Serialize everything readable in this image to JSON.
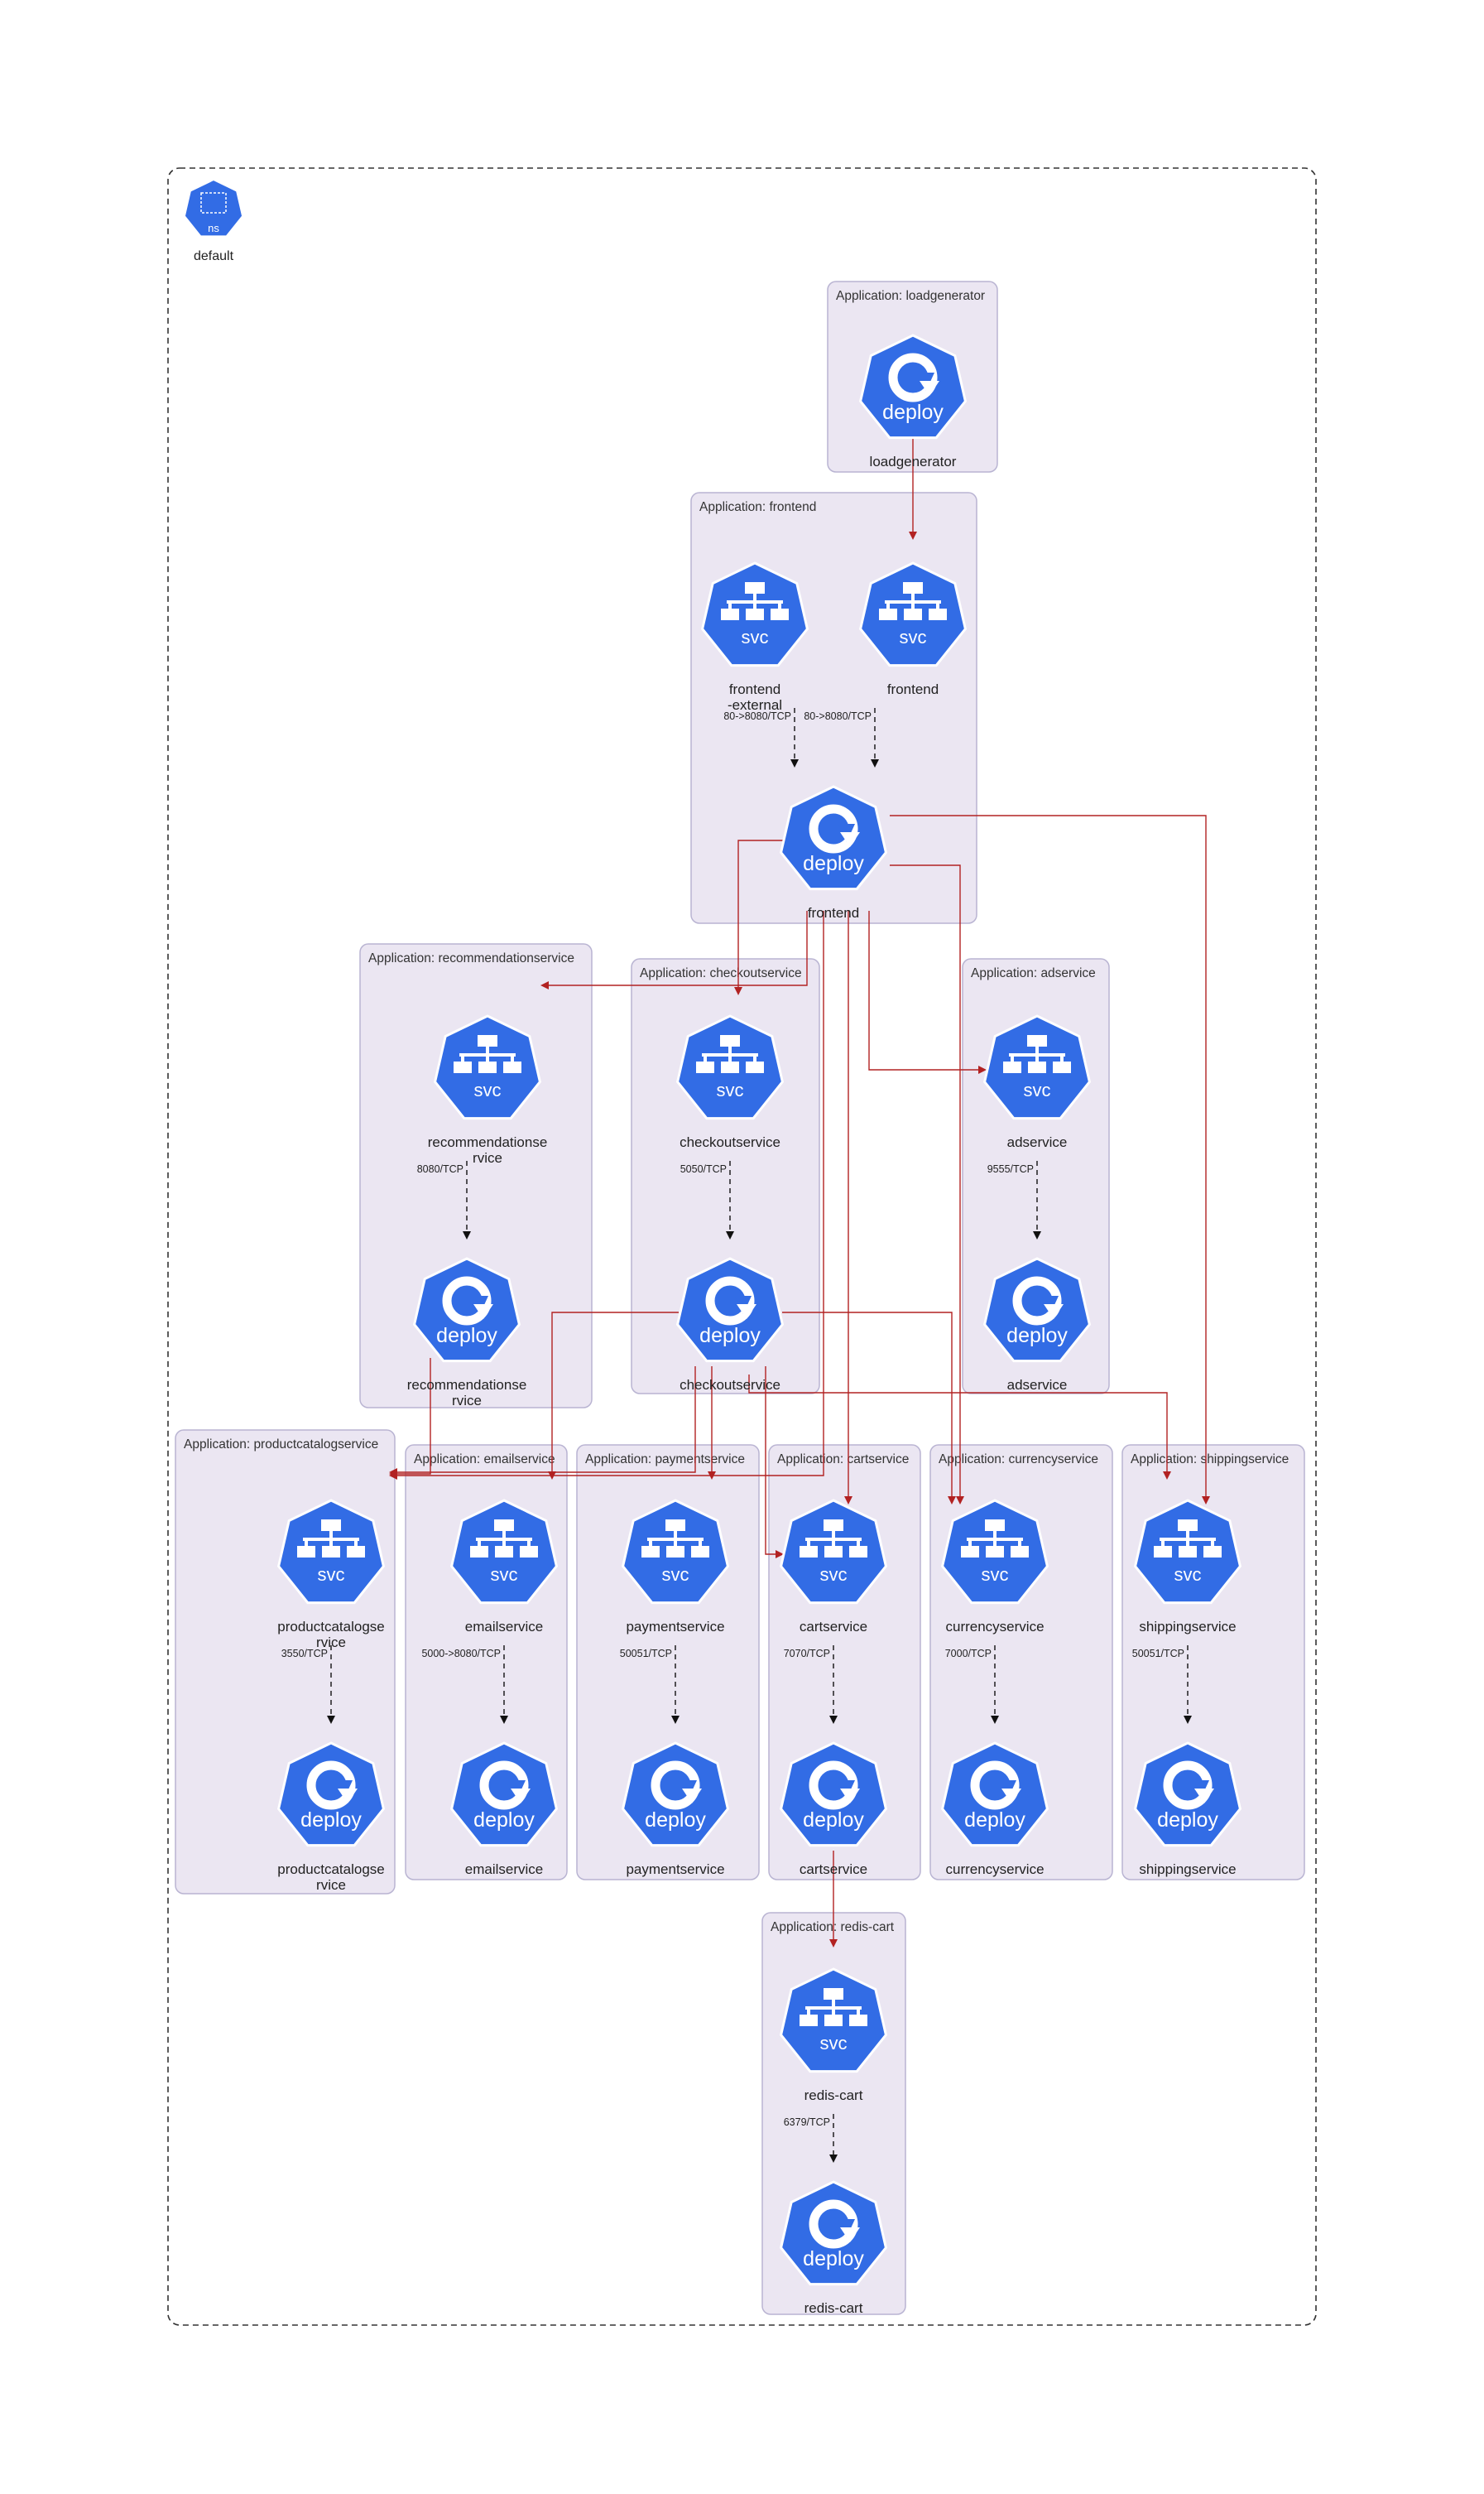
{
  "diagram": {
    "namespace": {
      "icon_text": "ns",
      "label": "default",
      "icon": "namespace-icon"
    },
    "colors": {
      "icon_fill": "#326ce5",
      "cluster_fill": "#ebe6f2",
      "cluster_stroke": "#b9b4d2",
      "traffic_edge": "#b22222",
      "port_edge": "#111111"
    },
    "clusters": [
      {
        "id": "loadgenerator",
        "title": "Application: loadgenerator"
      },
      {
        "id": "frontend",
        "title": "Application: frontend"
      },
      {
        "id": "recommendationservice",
        "title": "Application: recommendationservice"
      },
      {
        "id": "checkoutservice",
        "title": "Application: checkoutservice"
      },
      {
        "id": "adservice",
        "title": "Application: adservice"
      },
      {
        "id": "productcatalogservice",
        "title": "Application: productcatalogservice"
      },
      {
        "id": "emailservice",
        "title": "Application: emailservice"
      },
      {
        "id": "paymentservice",
        "title": "Application: paymentservice"
      },
      {
        "id": "cartservice",
        "title": "Application: cartservice"
      },
      {
        "id": "currencyservice",
        "title": "Application: currencyservice"
      },
      {
        "id": "shippingservice",
        "title": "Application: shippingservice"
      },
      {
        "id": "redis-cart",
        "title": "Application: redis-cart"
      }
    ],
    "nodes": [
      {
        "id": "loadgenerator-deploy",
        "kind": "deploy",
        "label": [
          "loadgenerator"
        ]
      },
      {
        "id": "frontend-external-svc",
        "kind": "svc",
        "label": [
          "frontend",
          "-external"
        ]
      },
      {
        "id": "frontend-svc",
        "kind": "svc",
        "label": [
          "frontend"
        ]
      },
      {
        "id": "frontend-deploy",
        "kind": "deploy",
        "label": [
          "frontend"
        ]
      },
      {
        "id": "recommendationservice-svc",
        "kind": "svc",
        "label": [
          "recommendationse",
          "rvice"
        ]
      },
      {
        "id": "recommendationservice-deploy",
        "kind": "deploy",
        "label": [
          "recommendationse",
          "rvice"
        ]
      },
      {
        "id": "checkoutservice-svc",
        "kind": "svc",
        "label": [
          "checkoutservice"
        ]
      },
      {
        "id": "checkoutservice-deploy",
        "kind": "deploy",
        "label": [
          "checkoutservice"
        ]
      },
      {
        "id": "adservice-svc",
        "kind": "svc",
        "label": [
          "adservice"
        ]
      },
      {
        "id": "adservice-deploy",
        "kind": "deploy",
        "label": [
          "adservice"
        ]
      },
      {
        "id": "productcatalogservice-svc",
        "kind": "svc",
        "label": [
          "productcatalogse",
          "rvice"
        ]
      },
      {
        "id": "productcatalogservice-deploy",
        "kind": "deploy",
        "label": [
          "productcatalogse",
          "rvice"
        ]
      },
      {
        "id": "emailservice-svc",
        "kind": "svc",
        "label": [
          "emailservice"
        ]
      },
      {
        "id": "emailservice-deploy",
        "kind": "deploy",
        "label": [
          "emailservice"
        ]
      },
      {
        "id": "paymentservice-svc",
        "kind": "svc",
        "label": [
          "paymentservice"
        ]
      },
      {
        "id": "paymentservice-deploy",
        "kind": "deploy",
        "label": [
          "paymentservice"
        ]
      },
      {
        "id": "cartservice-svc",
        "kind": "svc",
        "label": [
          "cartservice"
        ]
      },
      {
        "id": "cartservice-deploy",
        "kind": "deploy",
        "label": [
          "cartservice"
        ]
      },
      {
        "id": "currencyservice-svc",
        "kind": "svc",
        "label": [
          "currencyservice"
        ]
      },
      {
        "id": "currencyservice-deploy",
        "kind": "deploy",
        "label": [
          "currencyservice"
        ]
      },
      {
        "id": "shippingservice-svc",
        "kind": "svc",
        "label": [
          "shippingservice"
        ]
      },
      {
        "id": "shippingservice-deploy",
        "kind": "deploy",
        "label": [
          "shippingservice"
        ]
      },
      {
        "id": "redis-cart-svc",
        "kind": "svc",
        "label": [
          "redis-cart"
        ]
      },
      {
        "id": "redis-cart-deploy",
        "kind": "deploy",
        "label": [
          "redis-cart"
        ]
      }
    ],
    "port_edges": [
      {
        "from": "frontend-external-svc",
        "to": "frontend-deploy",
        "label": "80->8080/TCP"
      },
      {
        "from": "frontend-svc",
        "to": "frontend-deploy",
        "label": "80->8080/TCP"
      },
      {
        "from": "recommendationservice-svc",
        "to": "recommendationservice-deploy",
        "label": "8080/TCP"
      },
      {
        "from": "checkoutservice-svc",
        "to": "checkoutservice-deploy",
        "label": "5050/TCP"
      },
      {
        "from": "adservice-svc",
        "to": "adservice-deploy",
        "label": "9555/TCP"
      },
      {
        "from": "productcatalogservice-svc",
        "to": "productcatalogservice-deploy",
        "label": "3550/TCP"
      },
      {
        "from": "emailservice-svc",
        "to": "emailservice-deploy",
        "label": "5000->8080/TCP"
      },
      {
        "from": "paymentservice-svc",
        "to": "paymentservice-deploy",
        "label": "50051/TCP"
      },
      {
        "from": "cartservice-svc",
        "to": "cartservice-deploy",
        "label": "7070/TCP"
      },
      {
        "from": "currencyservice-svc",
        "to": "currencyservice-deploy",
        "label": "7000/TCP"
      },
      {
        "from": "shippingservice-svc",
        "to": "shippingservice-deploy",
        "label": "50051/TCP"
      },
      {
        "from": "redis-cart-svc",
        "to": "redis-cart-deploy",
        "label": "6379/TCP"
      }
    ],
    "traffic_edges": [
      {
        "from": "loadgenerator-deploy",
        "to": "frontend-svc"
      },
      {
        "from": "frontend-deploy",
        "to": "checkoutservice-svc"
      },
      {
        "from": "frontend-deploy",
        "to": "adservice-svc"
      },
      {
        "from": "frontend-deploy",
        "to": "recommendationservice"
      },
      {
        "from": "frontend-deploy",
        "to": "productcatalogservice"
      },
      {
        "from": "frontend-deploy",
        "to": "cartservice-svc"
      },
      {
        "from": "frontend-deploy",
        "to": "currencyservice-svc"
      },
      {
        "from": "frontend-deploy",
        "to": "shippingservice-svc"
      },
      {
        "from": "recommendationservice-deploy",
        "to": "productcatalogservice"
      },
      {
        "from": "checkoutservice-deploy",
        "to": "emailservice-svc"
      },
      {
        "from": "checkoutservice-deploy",
        "to": "paymentservice-svc"
      },
      {
        "from": "checkoutservice-deploy",
        "to": "cartservice-svc"
      },
      {
        "from": "checkoutservice-deploy",
        "to": "currencyservice-svc"
      },
      {
        "from": "checkoutservice-deploy",
        "to": "shippingservice-svc"
      },
      {
        "from": "checkoutservice-deploy",
        "to": "productcatalogservice"
      },
      {
        "from": "cartservice-deploy",
        "to": "redis-cart-svc"
      }
    ]
  }
}
